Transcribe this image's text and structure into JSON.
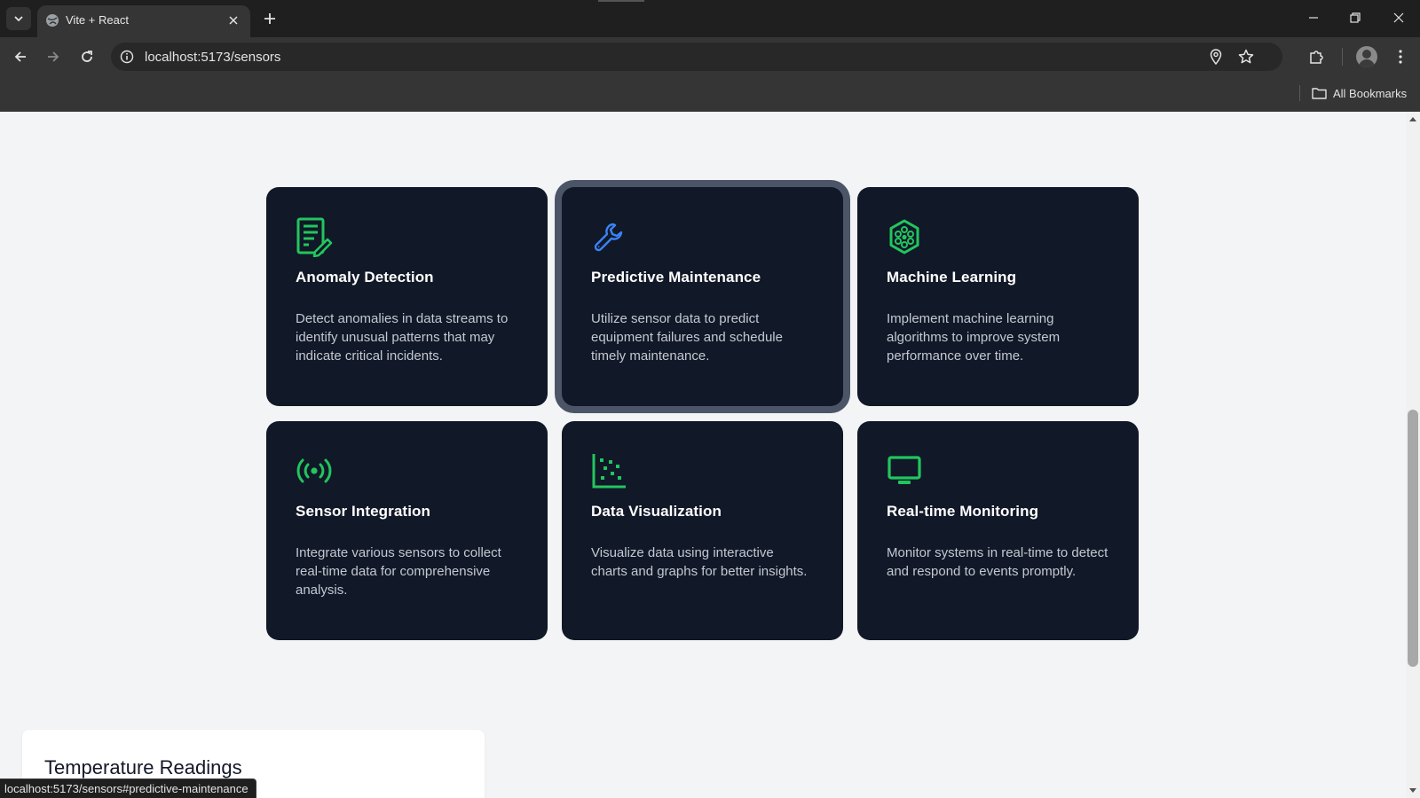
{
  "browser": {
    "tab": {
      "title": "Vite + React"
    },
    "address_bar": {
      "url": "localhost:5173/sensors"
    },
    "bookmarks": {
      "all_bookmarks_label": "All Bookmarks"
    },
    "status_url": "localhost:5173/sensors#predictive-maintenance"
  },
  "features": [
    {
      "id": "anomaly-detection",
      "icon": "document-edit-icon",
      "title": "Anomaly Detection",
      "description": "Detect anomalies in data streams to identify unusual patterns that may indicate critical incidents.",
      "icon_color": "#22c55e"
    },
    {
      "id": "predictive-maintenance",
      "icon": "wrench-icon",
      "title": "Predictive Maintenance",
      "description": "Utilize sensor data to predict equipment failures and schedule timely maintenance.",
      "icon_color": "#3b82f6",
      "focused": true
    },
    {
      "id": "machine-learning",
      "icon": "molecule-hexagon-icon",
      "title": "Machine Learning",
      "description": "Implement machine learning algorithms to improve system performance over time.",
      "icon_color": "#22c55e"
    },
    {
      "id": "sensor-integration",
      "icon": "broadcast-icon",
      "title": "Sensor Integration",
      "description": "Integrate various sensors to collect real-time data for comprehensive analysis.",
      "icon_color": "#22c55e"
    },
    {
      "id": "data-visualization",
      "icon": "scatter-chart-icon",
      "title": "Data Visualization",
      "description": "Visualize data using interactive charts and graphs for better insights.",
      "icon_color": "#22c55e"
    },
    {
      "id": "real-time-monitoring",
      "icon": "monitor-icon",
      "title": "Real-time Monitoring",
      "description": "Monitor systems in real-time to detect and respond to events promptly.",
      "icon_color": "#22c55e"
    }
  ],
  "temperature_section": {
    "title": "Temperature Readings"
  }
}
